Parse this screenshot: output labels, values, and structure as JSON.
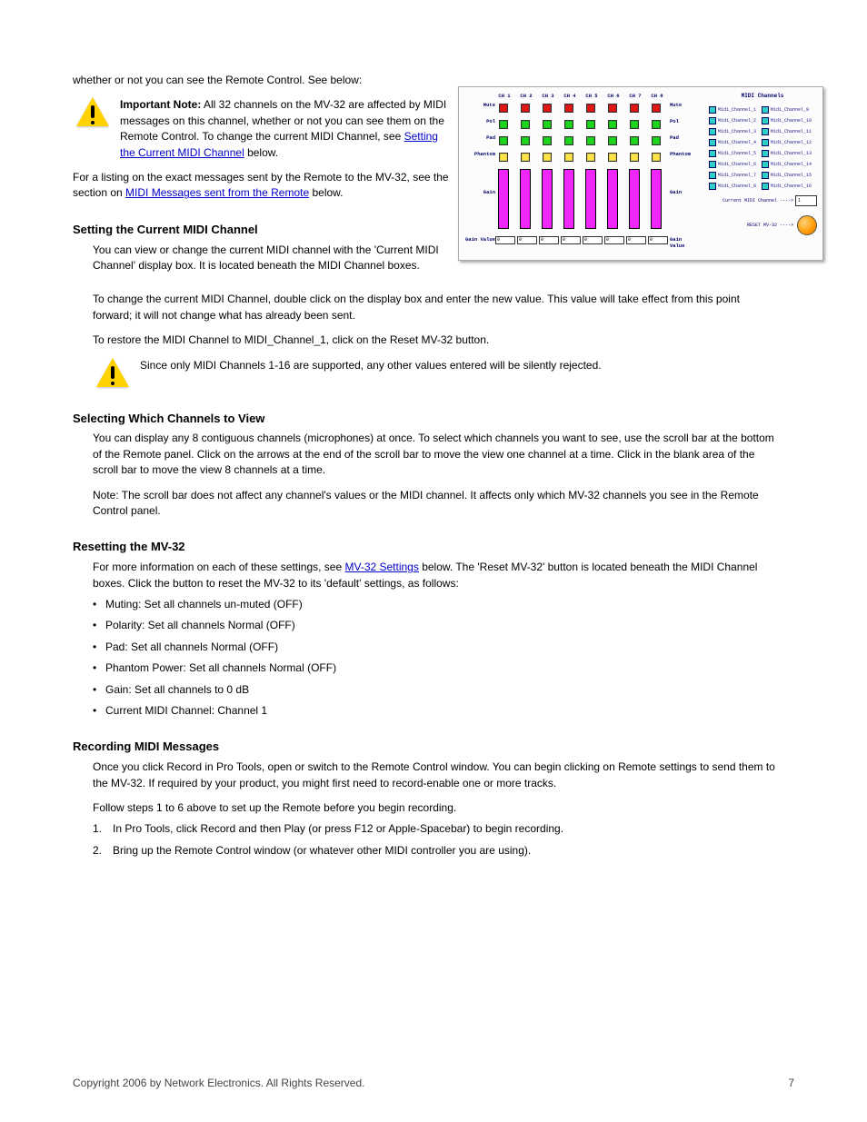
{
  "intro_para": "whether or not you can see the Remote Control. See below:",
  "warn1": {
    "bold": "Important Note:",
    "text": " All 32 channels on the MV-32 are affected by MIDI messages on this channel, whether or not you can see them on the Remote Control. To change the current MIDI Channel, see ",
    "link_text": "Setting the Current MIDI Channel",
    "after_link": " below."
  },
  "para_after_warn": "For a listing on the exact messages sent by the Remote to the MV-32, see the section on ",
  "link_midi_msgs": "MIDI Messages sent from the Remote",
  "para_after_link": " below.",
  "section1_title": "Setting the Current MIDI Channel",
  "section1_p1": "You can view or change the current MIDI channel with the 'Current MIDI Channel' display box. It is located beneath the MIDI Channel boxes.",
  "section1_p2": "To change the current MIDI Channel, double click on the display box and enter the new value. This value will take effect from this point forward; it will not change what has already been sent.",
  "section1_p3": "To restore the MIDI Channel to MIDI_Channel_1, click on the Reset MV-32 button.",
  "warn2_text": "Since only MIDI Channels 1-16 are supported, any other values entered will be silently rejected.",
  "section2_title": "Selecting Which Channels to View",
  "section2_p1": "You can display any 8 contiguous channels (microphones) at once. To select which channels you want to see, use the scroll bar at the bottom of the Remote panel. Click on the arrows at the end of the scroll bar to move the view one channel at a time. Click in the blank area of the scroll bar to move the view 8 channels at a time.",
  "section2_p2": "Note: The scroll bar does not affect any channel's values or the MIDI channel. It affects only which MV-32 channels you see in the Remote Control panel.",
  "section3_title": "Resetting the MV-32",
  "section3_p1_before_link": "For more information on each of these settings, see ",
  "section3_link": "MV-32 Settings",
  "section3_p1_after_link": " below. The 'Reset MV-32' button is located beneath the MIDI Channel boxes. Click the button to reset the MV-32 to its 'default' settings, as follows:",
  "bullets": [
    "Muting: Set all channels un-muted (OFF)",
    "Polarity: Set all channels Normal (OFF)",
    "Pad: Set all channels Normal (OFF)",
    "Phantom Power: Set all channels Normal (OFF)",
    "Gain: Set all channels to 0 dB",
    "Current MIDI Channel: Channel 1"
  ],
  "section4_title": "Recording MIDI Messages",
  "section4_p1": "Once you click Record in Pro Tools, open or switch to the Remote Control window. You can begin clicking on Remote settings to send them to the MV-32. If required by your product, you might first need to record-enable one or more tracks.",
  "section4_p2": "Follow steps 1 to 6 above to set up the Remote before you begin recording.",
  "section4_steps": [
    {
      "n": "1.",
      "t": "In Pro Tools, click Record and then Play (or press F12 or Apple-Spacebar) to begin recording."
    },
    {
      "n": "2.",
      "t": "Bring up the Remote Control window (or whatever other MIDI controller you are using)."
    }
  ],
  "footer_copyright": "Copyright 2006 by Network Electronics. All Rights Reserved.",
  "footer_page": "7",
  "panel": {
    "midi_title": "MIDI Channels",
    "row_labels": [
      "Mute",
      "Pol",
      "Pad",
      "Phantom",
      "Gain",
      "Gain Value"
    ],
    "ch_headers": [
      "CH 1",
      "CH 2",
      "CH 3",
      "CH 4",
      "CH 5",
      "CH 6",
      "CH 7",
      "CH 8"
    ],
    "gain_values": [
      "0",
      "0",
      "0",
      "0",
      "0",
      "0",
      "0",
      "0"
    ],
    "midi_buttons_left": [
      "Midi_Channel_1",
      "Midi_Channel_2",
      "Midi_Channel_3",
      "Midi_Channel_4",
      "Midi_Channel_5",
      "Midi_Channel_6",
      "Midi_Channel_7",
      "Midi_Channel_8"
    ],
    "midi_buttons_right": [
      "Midi_Channel_9",
      "Midi_Channel_10",
      "Midi_Channel_11",
      "Midi_Channel_12",
      "Midi_Channel_13",
      "Midi_Channel_14",
      "Midi_Channel_15",
      "Midi_Channel_16"
    ],
    "current_label": "Current MIDI Channel ---->",
    "current_value": "1",
    "reset_label": "RESET MV-32 ---->",
    "right_labels": {
      "mute": "Mute",
      "pol": "Pol",
      "pad": "Pad",
      "phantom": "Phantom",
      "gain": "Gain",
      "gainv": "Gain Value"
    }
  }
}
